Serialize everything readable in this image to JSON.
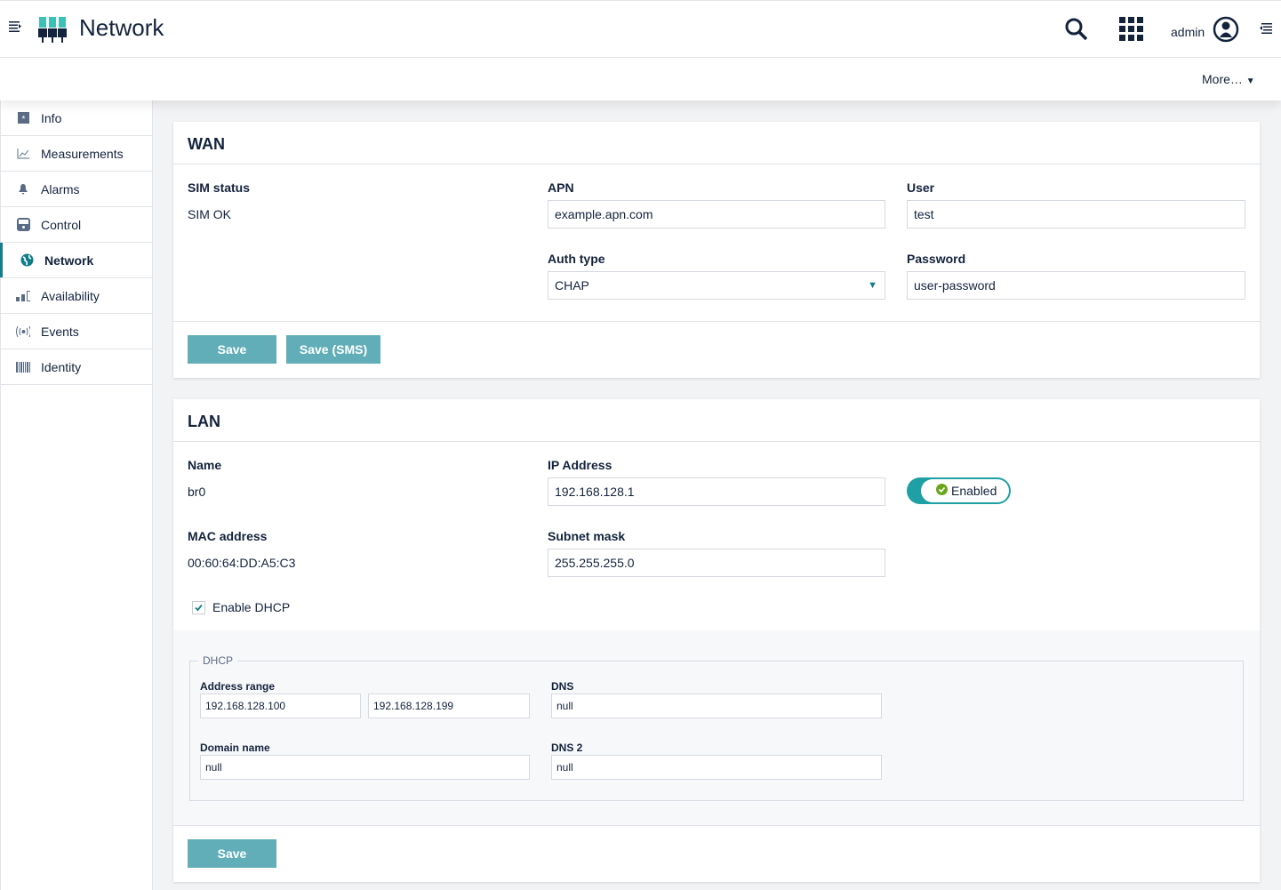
{
  "header": {
    "title": "Network",
    "user": "admin",
    "more": "More…"
  },
  "sidebar": {
    "items": [
      {
        "label": "Info",
        "icon": "info-icon"
      },
      {
        "label": "Measurements",
        "icon": "chart-icon"
      },
      {
        "label": "Alarms",
        "icon": "bell-icon"
      },
      {
        "label": "Control",
        "icon": "control-icon"
      },
      {
        "label": "Network",
        "icon": "globe-icon",
        "active": true
      },
      {
        "label": "Availability",
        "icon": "signal-bars-icon"
      },
      {
        "label": "Events",
        "icon": "broadcast-icon"
      },
      {
        "label": "Identity",
        "icon": "barcode-icon"
      }
    ]
  },
  "wan": {
    "title": "WAN",
    "sim_status_label": "SIM status",
    "sim_status": "SIM OK",
    "apn_label": "APN",
    "apn": "example.apn.com",
    "user_label": "User",
    "user": "test",
    "auth_label": "Auth type",
    "auth": "CHAP",
    "password_label": "Password",
    "password": "user-password",
    "save": "Save",
    "save_sms": "Save (SMS)"
  },
  "lan": {
    "title": "LAN",
    "name_label": "Name",
    "name": "br0",
    "ip_label": "IP Address",
    "ip": "192.168.128.1",
    "enabled": "Enabled",
    "mac_label": "MAC address",
    "mac": "00:60:64:DD:A5:C3",
    "subnet_label": "Subnet mask",
    "subnet": "255.255.255.0",
    "dhcp_checkbox": "Enable DHCP",
    "dhcp_enabled": true,
    "save": "Save",
    "dhcp": {
      "legend": "DHCP",
      "range_label": "Address range",
      "range_start": "192.168.128.100",
      "range_end": "192.168.128.199",
      "dns_label": "DNS",
      "dns": "null",
      "domain_label": "Domain name",
      "domain": "null",
      "dns2_label": "DNS 2",
      "dns2": "null"
    }
  },
  "colors": {
    "accent": "#137d8a",
    "button": "#62aeb8",
    "logo": "#3cc1b7"
  }
}
